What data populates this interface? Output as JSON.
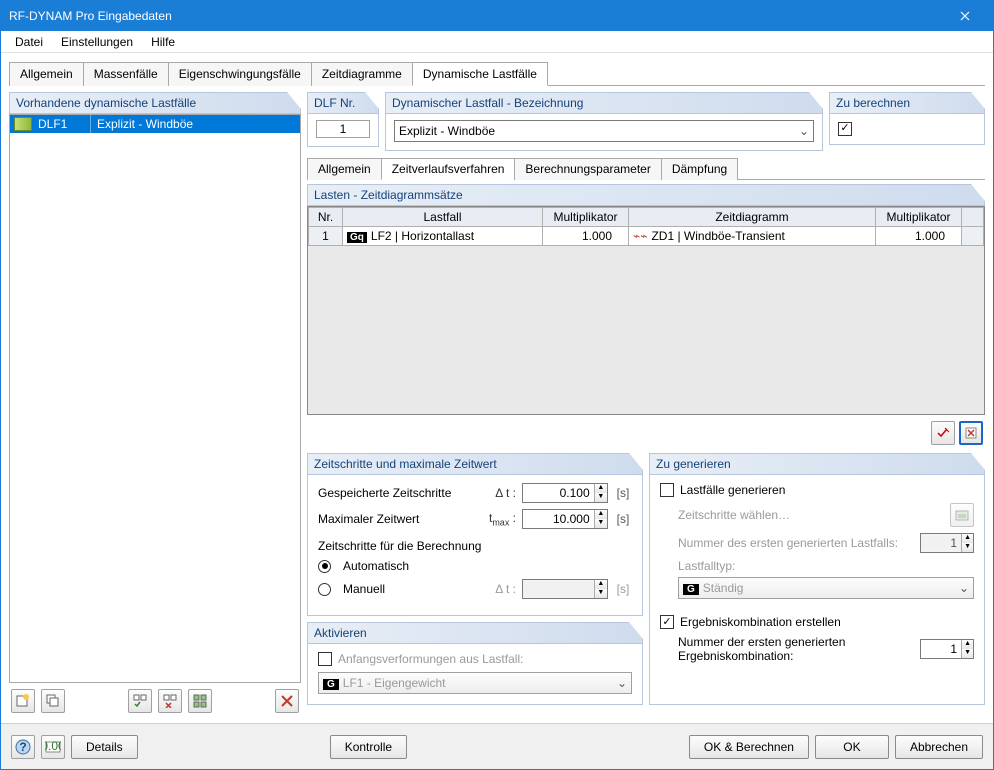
{
  "window": {
    "title": "RF-DYNAM Pro Eingabedaten"
  },
  "menu": {
    "file": "Datei",
    "settings": "Einstellungen",
    "help": "Hilfe"
  },
  "tabs": {
    "general": "Allgemein",
    "masscases": "Massenfälle",
    "eigen": "Eigenschwingungsfälle",
    "timediag": "Zeitdiagramme",
    "dlf": "Dynamische Lastfälle"
  },
  "left": {
    "header": "Vorhandene dynamische Lastfälle",
    "row_code": "DLF1",
    "row_desc": "Explizit - Windböe"
  },
  "top": {
    "dlf_nr_header": "DLF Nr.",
    "dlf_nr_value": "1",
    "desc_header": "Dynamischer Lastfall - Bezeichnung",
    "desc_value": "Explizit - Windböe",
    "calc_header": "Zu berechnen"
  },
  "subtabs": {
    "general": "Allgemein",
    "zvv": "Zeitverlaufsverfahren",
    "bparam": "Berechnungsparameter",
    "damp": "Dämpfung"
  },
  "loads": {
    "header": "Lasten - Zeitdiagrammsätze",
    "th_nr": "Nr.",
    "th_lastfall": "Lastfall",
    "th_mult1": "Multiplikator",
    "th_zeit": "Zeitdiagramm",
    "th_mult2": "Multiplikator",
    "row": {
      "nr": "1",
      "lf_tag": "Gq",
      "lf_text": "LF2 | Horizontallast",
      "mult1": "1.000",
      "zd_text": "ZD1 | Windböe-Transient",
      "mult2": "1.000"
    }
  },
  "timestep": {
    "header": "Zeitschritte und maximale Zeitwert",
    "stored_label": "Gespeicherte Zeitschritte",
    "dt_sym": "Δ t :",
    "dt_val": "0.100",
    "unit_s": "[s]",
    "tmax_label": "Maximaler Zeitwert",
    "tmax_sym": "tmax :",
    "tmax_val": "10.000",
    "calc_ts_label": "Zeitschritte für die Berechnung",
    "auto": "Automatisch",
    "manual": "Manuell",
    "dt2_sym": "Δ t :"
  },
  "generate": {
    "header": "Zu generieren",
    "lf_gen": "Lastfälle generieren",
    "choose_ts": "Zeitschritte wählen…",
    "first_lf_label": "Nummer des ersten generierten Lastfalls:",
    "first_lf_val": "1",
    "lf_type_label": "Lastfalltyp:",
    "lf_type_val": "Ständig",
    "rc_create": "Ergebniskombination erstellen",
    "first_rc_label": "Nummer der ersten generierten Ergebniskombination:",
    "first_rc_val": "1"
  },
  "activate": {
    "header": "Aktivieren",
    "initial_def": "Anfangsverformungen aus Lastfall:",
    "lf1": "LF1 - Eigengewicht"
  },
  "footer": {
    "details": "Details",
    "kontrolle": "Kontrolle",
    "ok_calc": "OK & Berechnen",
    "ok": "OK",
    "cancel": "Abbrechen"
  }
}
